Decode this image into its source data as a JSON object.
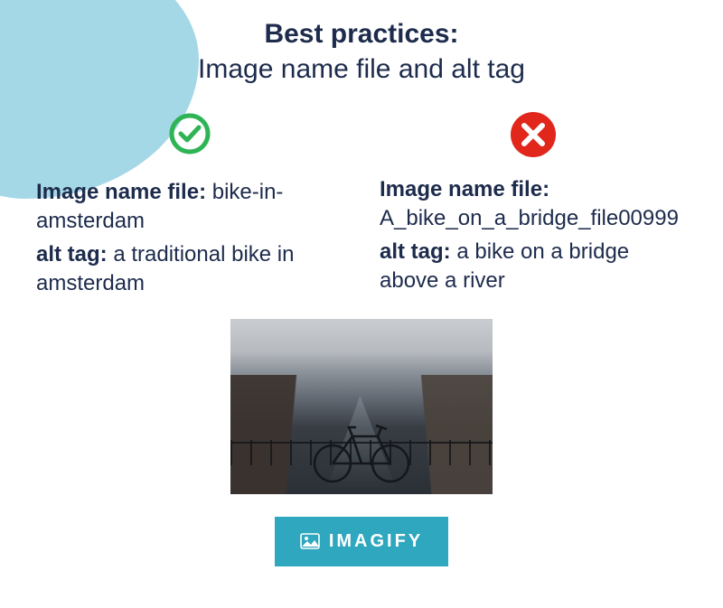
{
  "heading": {
    "main": "Best practices:",
    "sub": "Image name file and alt tag"
  },
  "good": {
    "filename_label": "Image name file:",
    "filename_value": "bike-in-amsterdam",
    "alttag_label": "alt tag:",
    "alttag_value": "a traditional bike in amsterdam"
  },
  "bad": {
    "filename_label": "Image name file:",
    "filename_value": "A_bike_on_a_bridge_file00999",
    "alttag_label": "alt tag:",
    "alttag_value": "a bike on a bridge above a river"
  },
  "brand": {
    "name": "IMAGIFY"
  }
}
